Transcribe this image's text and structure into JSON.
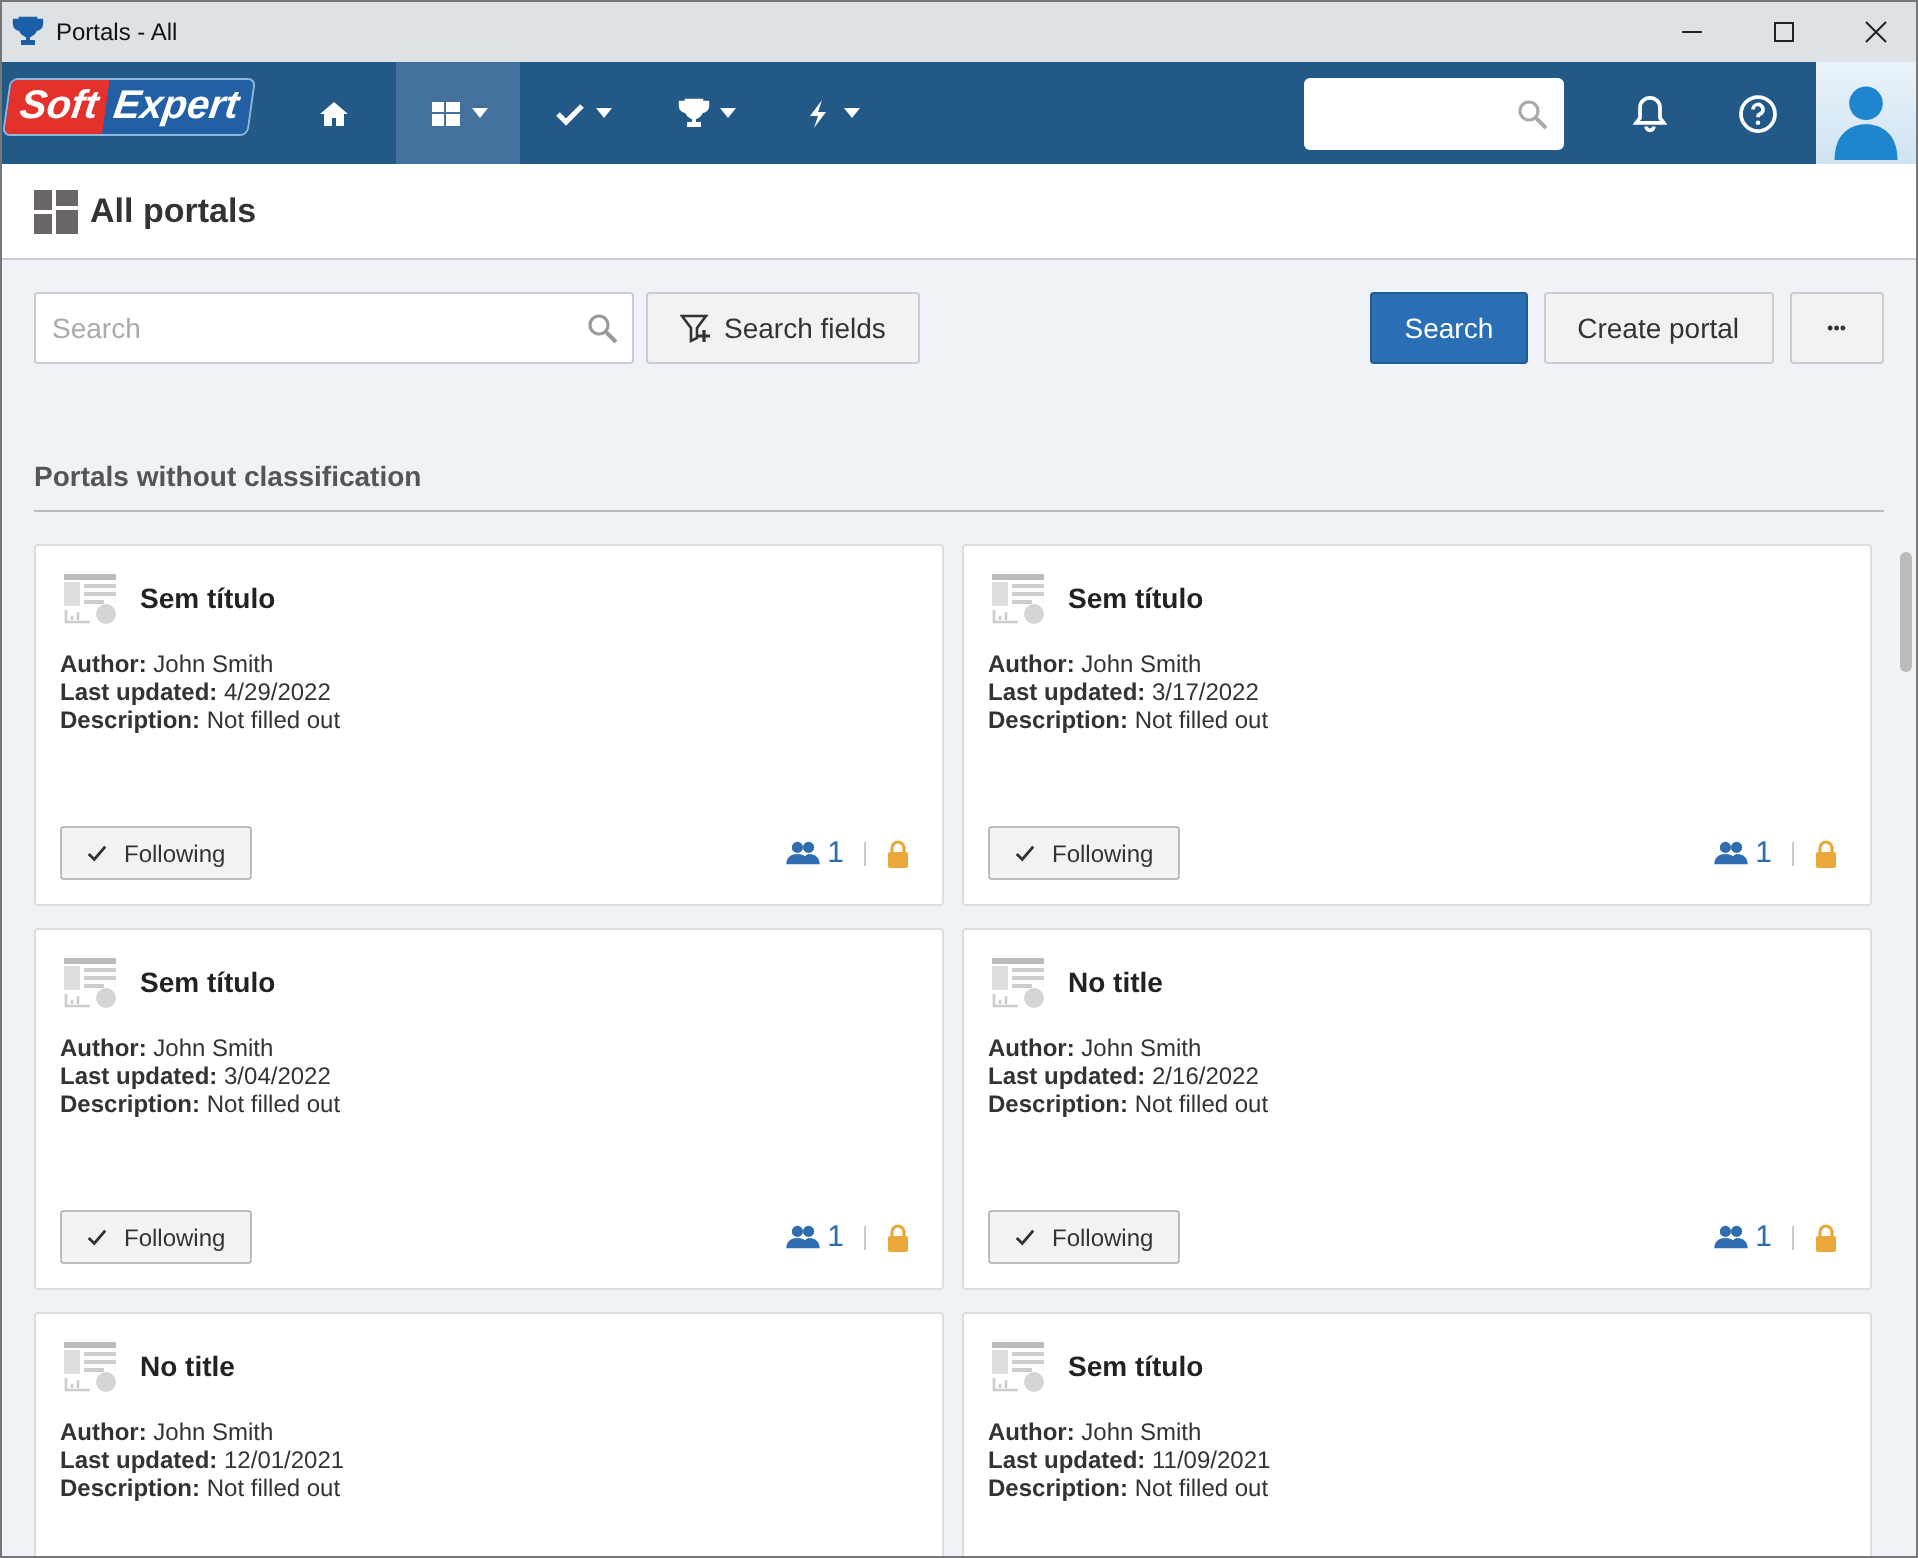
{
  "window": {
    "title": "Portals - All"
  },
  "logo": {
    "part_1": "Soft",
    "part_2": "Expert"
  },
  "nav": [
    {
      "kind": "home",
      "selected": false,
      "dropdown": false
    },
    {
      "kind": "portals",
      "selected": true,
      "dropdown": true
    },
    {
      "kind": "check",
      "selected": false,
      "dropdown": true
    },
    {
      "kind": "trophy",
      "selected": false,
      "dropdown": true
    },
    {
      "kind": "bolt",
      "selected": false,
      "dropdown": true
    }
  ],
  "page": {
    "title": "All portals"
  },
  "toolbar": {
    "search_placeholder": "Search",
    "search_fields": "Search fields",
    "search_button": "Search",
    "create_button": "Create portal",
    "more_button": "•••"
  },
  "section": {
    "title": "Portals without classification"
  },
  "cards": [
    {
      "title": "Sem título",
      "author": "**Author:** John Smith",
      "updated": "**Last updated:** 4/29/2022",
      "description": "**Description:** Not filled out",
      "following": true,
      "follow_label": "Following",
      "members": "1"
    },
    {
      "title": "Sem título",
      "author": "**Author:** John Smith",
      "updated": "**Last updated:** 3/17/2022",
      "description": "**Description:** Not filled out",
      "following": true,
      "follow_label": "Following",
      "members": "1"
    },
    {
      "title": "Sem título",
      "author": "**Author:** John Smith",
      "updated": "**Last updated:** 3/04/2022",
      "description": "**Description:** Not filled out",
      "following": true,
      "follow_label": "Following",
      "members": "1"
    },
    {
      "title": "No title",
      "author": "**Author:** John Smith",
      "updated": "**Last updated:** 2/16/2022",
      "description": "**Description:** Not filled out",
      "following": true,
      "follow_label": "Following",
      "members": "1"
    },
    {
      "title": "No title",
      "author": "**Author:** John Smith",
      "updated": "**Last updated:** 12/01/2021",
      "description": "**Description:** Not filled out"
    },
    {
      "title": "Sem título",
      "author": "**Author:** John Smith",
      "updated": "**Last updated:** 11/09/2021",
      "description": "**Description:** Not filled out"
    }
  ]
}
